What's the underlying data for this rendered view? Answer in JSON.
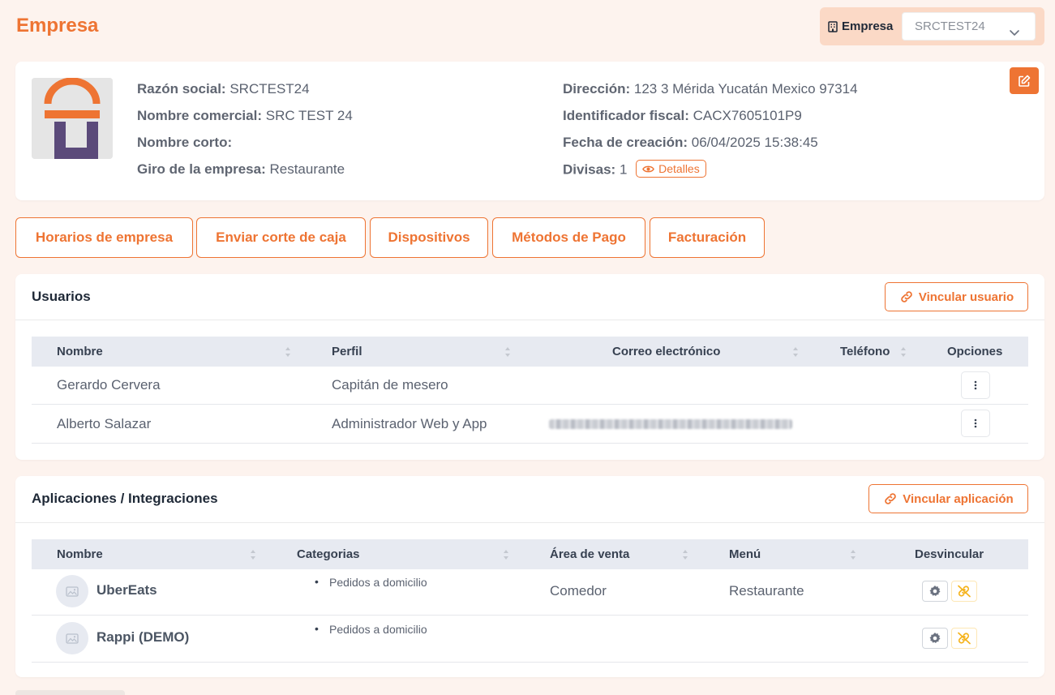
{
  "header": {
    "title": "Empresa",
    "company_label": "Empresa",
    "company_selected": "SRCTEST24"
  },
  "company_info": {
    "razon_social_label": "Razón social:",
    "razon_social": "SRCTEST24",
    "nombre_comercial_label": "Nombre comercial:",
    "nombre_comercial": "SRC TEST 24",
    "nombre_corto_label": "Nombre corto:",
    "nombre_corto": "",
    "giro_label": "Giro de la empresa:",
    "giro": "Restaurante",
    "direccion_label": "Dirección:",
    "direccion": "123 3 Mérida Yucatán Mexico 97314",
    "identificador_label": "Identificador fiscal:",
    "identificador": "CACX7605101P9",
    "fecha_label": "Fecha de creación:",
    "fecha": "06/04/2025 15:38:45",
    "divisas_label": "Divisas:",
    "divisas": "1",
    "detalles_label": "Detalles"
  },
  "tabs": [
    {
      "label": "Horarios de empresa"
    },
    {
      "label": "Enviar corte de caja"
    },
    {
      "label": "Dispositivos"
    },
    {
      "label": "Métodos de Pago"
    },
    {
      "label": "Facturación"
    }
  ],
  "users": {
    "title": "Usuarios",
    "link_button": "Vincular usuario",
    "columns": [
      "Nombre",
      "Perfil",
      "Correo electrónico",
      "Teléfono",
      "Opciones"
    ],
    "rows": [
      {
        "nombre": "Gerardo Cervera",
        "perfil": "Capitán de mesero",
        "correo": "",
        "telefono": ""
      },
      {
        "nombre": "Alberto Salazar",
        "perfil": "Administrador Web y App",
        "correo": "",
        "telefono": ""
      }
    ]
  },
  "apps": {
    "title": "Aplicaciones / Integraciones",
    "link_button": "Vincular aplicación",
    "columns": [
      "Nombre",
      "Categorias",
      "Área de venta",
      "Menú",
      "Desvincular"
    ],
    "rows": [
      {
        "nombre": "UberEats",
        "categoria": "Pedidos a domicilio",
        "area": "Comedor",
        "menu": "Restaurante"
      },
      {
        "nombre": "Rappi (DEMO)",
        "categoria": "Pedidos a domicilio",
        "area": "",
        "menu": ""
      }
    ]
  },
  "colors": {
    "accent": "#ee7433",
    "background": "#fdf3ee",
    "logo_purple": "#5b4a7a",
    "warning": "#f5b31c"
  },
  "icons": [
    "building-icon",
    "chevron-down-icon",
    "edit-icon",
    "eye-icon",
    "link-icon",
    "sort-icon",
    "dots-vertical-icon",
    "image-placeholder-icon",
    "gear-icon",
    "unlink-icon"
  ]
}
